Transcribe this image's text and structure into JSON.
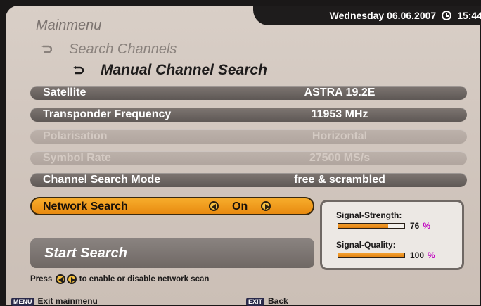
{
  "header": {
    "datetime": "Wednesday 06.06.2007",
    "time": "15:44",
    "clock_icon": "clock-icon"
  },
  "breadcrumb": {
    "main": "Mainmenu",
    "sub": "Search Channels",
    "current": "Manual Channel Search"
  },
  "settings": [
    {
      "label": "Satellite",
      "value": "ASTRA 19.2E",
      "enabled": true
    },
    {
      "label": "Transponder Frequency",
      "value": "11953 MHz",
      "enabled": true
    },
    {
      "label": "Polarisation",
      "value": "Horizontal",
      "enabled": false
    },
    {
      "label": "Symbol Rate",
      "value": "27500 MS/s",
      "enabled": false
    },
    {
      "label": "Channel Search Mode",
      "value": "free & scrambled",
      "enabled": true
    }
  ],
  "network_search": {
    "label": "Network Search",
    "value": "On"
  },
  "start_search": {
    "label": "Start Search"
  },
  "signal": {
    "strength_label": "Signal-Strength:",
    "strength_value": "76",
    "strength_unit": "%",
    "strength_fraction": 0.76,
    "quality_label": "Signal-Quality:",
    "quality_value": "100",
    "quality_unit": "%",
    "quality_fraction": 1.0
  },
  "hint": {
    "prefix": "Press",
    "suffix": "to enable or disable network scan"
  },
  "footer": {
    "menu_key": "MENU",
    "menu_label": "Exit mainmenu",
    "exit_key": "EXIT",
    "exit_label": "Back"
  },
  "colors": {
    "accent": "#f0a020",
    "row": "#6e6764",
    "background": "#d2c7bf"
  }
}
